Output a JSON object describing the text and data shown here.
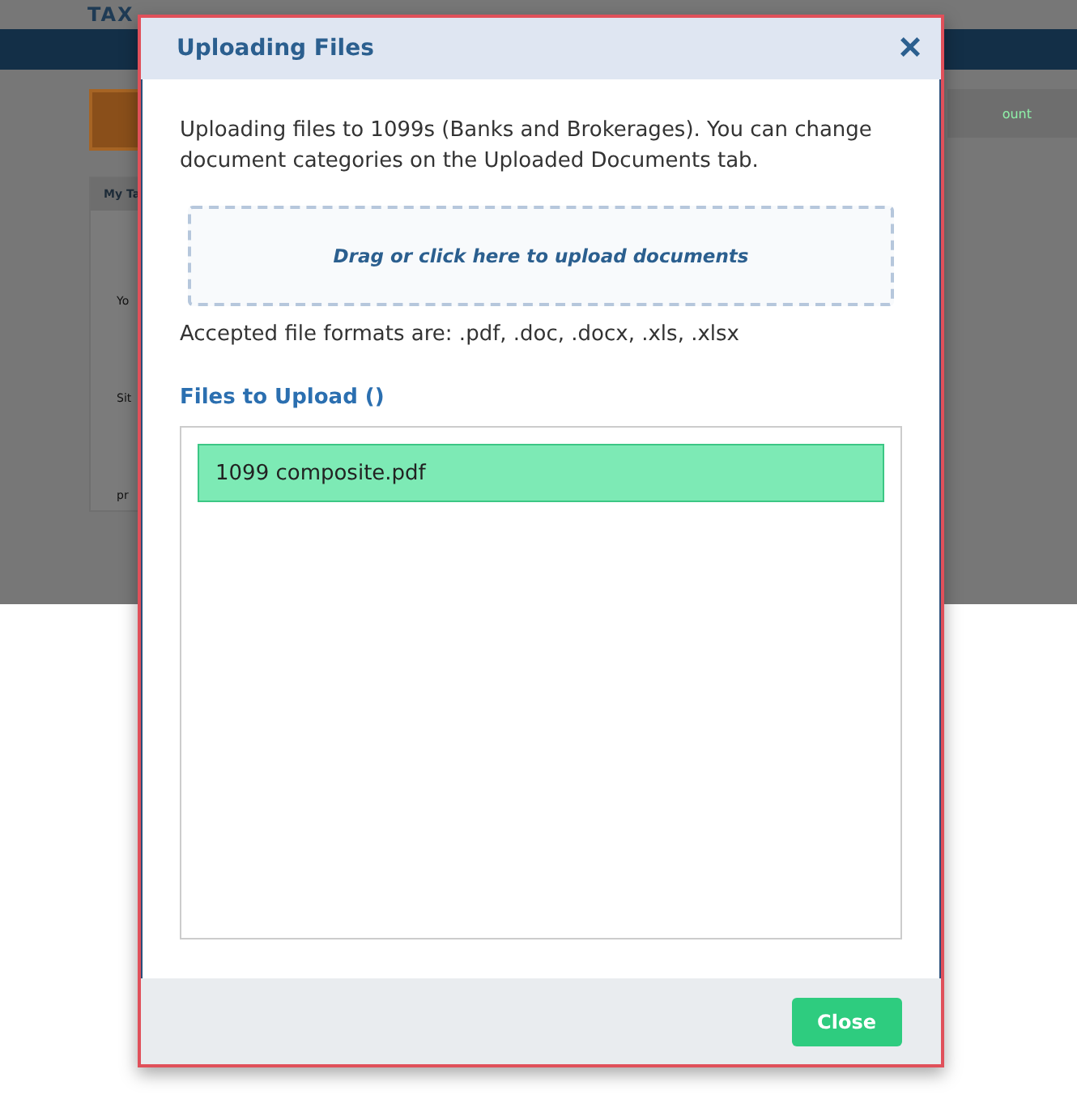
{
  "background": {
    "logo": "TAX",
    "card_tab": "My Ta",
    "card_texts": [
      "Yo",
      "Sit",
      "pr"
    ],
    "right_link": "ount"
  },
  "dialog": {
    "title": "Uploading Files",
    "close_glyph": "×",
    "intro": "Uploading files to 1099s (Banks and Brokerages). You can change document categories on the Uploaded Documents tab.",
    "dropzone": "Drag or click here to upload documents",
    "formats": "Accepted file formats are: .pdf, .doc, .docx, .xls, .xlsx",
    "files_heading": "Files to Upload ()",
    "files": [
      {
        "name": "1099 composite.pdf"
      }
    ],
    "close_button": "Close"
  }
}
